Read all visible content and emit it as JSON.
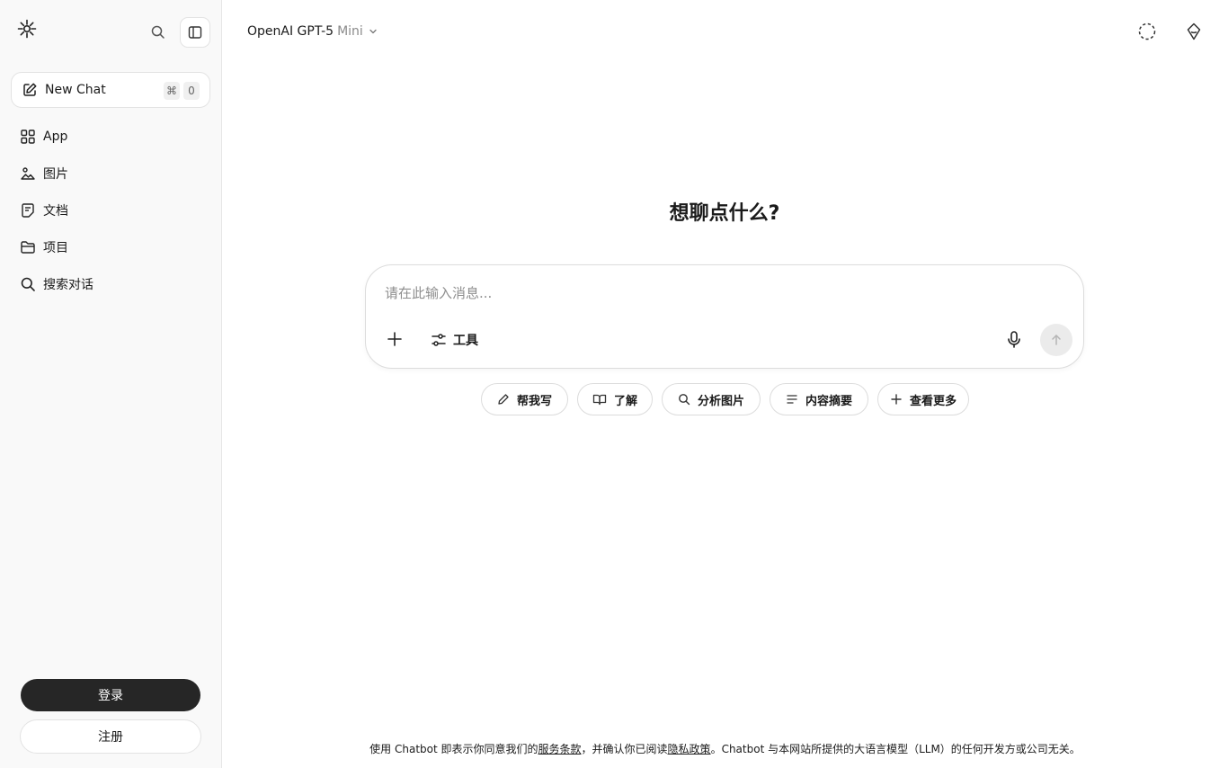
{
  "sidebar": {
    "new_chat": {
      "label": "New Chat",
      "shortcut_symbol": "⌘",
      "shortcut_key": "0"
    },
    "items": [
      {
        "label": "App",
        "icon": "grid-icon"
      },
      {
        "label": "图片",
        "icon": "image-icon"
      },
      {
        "label": "文档",
        "icon": "document-icon"
      },
      {
        "label": "项目",
        "icon": "folder-icon"
      },
      {
        "label": "搜索对话",
        "icon": "search-icon"
      }
    ],
    "login_label": "登录",
    "signup_label": "注册"
  },
  "header": {
    "model_name": "OpenAI GPT-5",
    "model_variant": "Mini"
  },
  "main": {
    "heading": "想聊点什么?",
    "composer": {
      "placeholder": "请在此输入消息...",
      "tools_label": "工具"
    },
    "suggestions": [
      {
        "label": "帮我写",
        "icon": "pencil-icon"
      },
      {
        "label": "了解",
        "icon": "book-icon"
      },
      {
        "label": "分析图片",
        "icon": "search-icon"
      },
      {
        "label": "内容摘要",
        "icon": "lines-icon"
      },
      {
        "label": "查看更多",
        "icon": "plus-icon"
      }
    ]
  },
  "footer": {
    "text_before": "使用 Chatbot 即表示你同意我们的",
    "terms_link": "服务条款",
    "text_middle": "，并确认你已阅读",
    "privacy_link": "隐私政策",
    "text_after": "。Chatbot 与本网站所提供的大语言模型（LLM）的任何开发方或公司无关。"
  }
}
